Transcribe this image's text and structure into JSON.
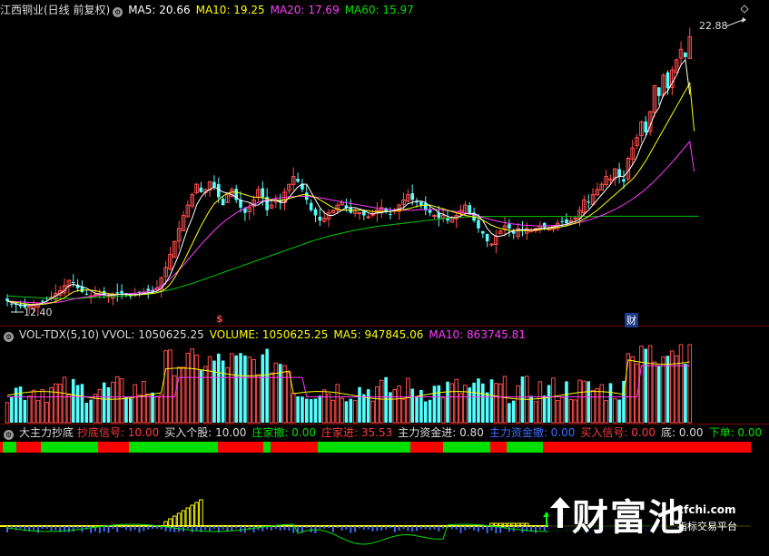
{
  "price_header": {
    "title": "江西铜业(日线 前复权)",
    "ma5": "MA5: 20.66",
    "ma10": "MA10: 19.25",
    "ma20": "MA20: 17.69",
    "ma60": "MA60: 15.97"
  },
  "price_labels": {
    "high": "22.88",
    "low": "12.40",
    "marker_s": "$",
    "marker_cai": "财"
  },
  "vol_header": {
    "title": "VOL-TDX(5,10)",
    "vvol": "VVOL: 1050625.25",
    "volume": "VOLUME: 1050625.25",
    "ma5": "MA5: 947845.06",
    "ma10": "MA10: 863745.81"
  },
  "ind_header": {
    "title": "大主力抄底",
    "bottom_signal": "抄底信号: 10.00",
    "buy_stock": "买入个股: 10.00",
    "dealer_withdraw": "庄家撤: 0.00",
    "dealer_enter": "庄家进: 35.53",
    "capital_in": "主力资金进: 0.80",
    "capital_out": "主力资金撤: 0.00",
    "buy_signal": "买入信号: 0.00",
    "bottom": "底: 0.00",
    "sell": "下单: 0.00"
  },
  "ind_labels": {
    "buy": "买"
  },
  "watermark": {
    "name": "财富池",
    "url": "cfchi.com",
    "sub": "指标交易平台"
  },
  "colors": {
    "up": "#ff4d4d",
    "down": "#54ffff",
    "ma5": "#ffffff",
    "ma10": "#ffff00",
    "ma20": "#ff3bff",
    "ma60": "#00c800",
    "grid": "#7a0000",
    "green_bar": "#00e000",
    "red_bar": "#ff0000"
  },
  "chart_data": {
    "type": "candlestick",
    "x": [
      1,
      2,
      3,
      4,
      5,
      6,
      7,
      8,
      9,
      10,
      11,
      12,
      13,
      14,
      15,
      16,
      17,
      18,
      19,
      20,
      21,
      22,
      23,
      24,
      25,
      26,
      27,
      28,
      29,
      30,
      31,
      32,
      33,
      34,
      35,
      36,
      37,
      38,
      39,
      40,
      41,
      42,
      43,
      44,
      45,
      46,
      47,
      48,
      49,
      50,
      51,
      52,
      53,
      54,
      55,
      56,
      57,
      58,
      59,
      60,
      61,
      62,
      63,
      64,
      65,
      66,
      67,
      68,
      69,
      70,
      71,
      72,
      73,
      74,
      75,
      76,
      77,
      78,
      79,
      80,
      81,
      82,
      83,
      84,
      85,
      86,
      87,
      88,
      89,
      90,
      91,
      92,
      93,
      94,
      95,
      96,
      97,
      98,
      99,
      100,
      101,
      102,
      103,
      104,
      105,
      106,
      107,
      108,
      109,
      110,
      111,
      112,
      113,
      114,
      115,
      116,
      117,
      118,
      119,
      120,
      121,
      122,
      123,
      124,
      125,
      126,
      127,
      128,
      129,
      130,
      131,
      132,
      133,
      134,
      135,
      136,
      137,
      138,
      139,
      140,
      141,
      142,
      143,
      144,
      145,
      146,
      147,
      148,
      149,
      150,
      151,
      152,
      153,
      154,
      155,
      156,
      157,
      158,
      159,
      160,
      161,
      162,
      163,
      164,
      165,
      166,
      167,
      168,
      169,
      170
    ],
    "close": [
      12.7,
      12.6,
      12.55,
      12.5,
      12.45,
      12.5,
      12.55,
      12.6,
      12.7,
      12.8,
      12.85,
      13.0,
      13.1,
      13.3,
      13.5,
      13.4,
      13.2,
      13.05,
      12.95,
      12.9,
      12.95,
      13.0,
      12.95,
      12.9,
      12.95,
      13.0,
      13.0,
      12.95,
      12.9,
      12.95,
      13.0,
      13.05,
      13.1,
      13.05,
      13.2,
      13.6,
      14.0,
      14.5,
      15.0,
      15.5,
      16.0,
      16.4,
      16.8,
      17.2,
      16.9,
      17.0,
      17.3,
      17.1,
      16.7,
      16.4,
      16.8,
      17.0,
      16.6,
      16.3,
      16.1,
      16.3,
      16.6,
      17.0,
      16.7,
      16.2,
      16.4,
      16.6,
      16.5,
      16.9,
      17.2,
      17.5,
      17.3,
      17.0,
      16.6,
      16.2,
      16.0,
      15.8,
      15.9,
      16.1,
      16.2,
      16.4,
      16.5,
      16.3,
      16.1,
      16.2,
      16.1,
      16.0,
      15.95,
      16.05,
      16.2,
      16.3,
      16.15,
      16.05,
      16.2,
      16.4,
      16.6,
      16.8,
      16.6,
      16.5,
      16.4,
      16.2,
      16.1,
      16.0,
      15.9,
      16.0,
      15.8,
      15.9,
      16.0,
      16.2,
      16.4,
      16.1,
      15.8,
      15.5,
      15.3,
      15.0,
      14.9,
      15.2,
      15.4,
      15.6,
      15.5,
      15.3,
      15.5,
      15.4,
      15.5,
      15.45,
      15.5,
      15.6,
      15.55,
      15.5,
      15.6,
      15.7,
      15.75,
      15.7,
      15.8,
      15.9,
      16.2,
      16.6,
      16.5,
      16.8,
      17.0,
      17.2,
      17.5,
      17.4,
      17.8,
      17.5,
      17.3,
      18.2,
      18.6,
      19.0,
      19.6,
      19.2,
      20.0,
      21.0,
      20.6,
      21.4,
      20.9,
      21.6,
      22.0,
      22.4,
      22.1,
      22.88
    ],
    "ma5": [
      12.7,
      12.65,
      12.6,
      12.55,
      12.55,
      12.55,
      12.55,
      12.57,
      12.63,
      12.7,
      12.8,
      12.9,
      13.0,
      13.1,
      13.3,
      13.35,
      13.3,
      13.25,
      13.2,
      13.1,
      13.0,
      12.97,
      12.95,
      12.93,
      12.93,
      12.95,
      12.97,
      12.96,
      12.95,
      12.95,
      12.96,
      12.99,
      13.02,
      13.04,
      13.08,
      13.2,
      13.4,
      13.7,
      14.1,
      14.5,
      15.0,
      15.5,
      15.9,
      16.4,
      16.7,
      16.9,
      17.0,
      17.1,
      17.0,
      16.9,
      16.86,
      16.8,
      16.7,
      16.57,
      16.54,
      16.5,
      16.4,
      16.4,
      16.54,
      16.56,
      16.57,
      16.6,
      16.5,
      16.5,
      16.7,
      16.9,
      17.1,
      17.2,
      17.2,
      16.9,
      16.6,
      16.3,
      16.1,
      16.0,
      16.0,
      16.1,
      16.2,
      16.3,
      16.3,
      16.3,
      16.25,
      16.2,
      16.1,
      16.06,
      16.1,
      16.1,
      16.15,
      16.15,
      16.2,
      16.25,
      16.3,
      16.45,
      16.5,
      16.55,
      16.55,
      16.5,
      16.35,
      16.25,
      16.1,
      16.05,
      15.96,
      15.92,
      15.92,
      15.98,
      16.06,
      16.08,
      16.06,
      16.0,
      15.8,
      15.5,
      15.3,
      15.2,
      15.2,
      15.25,
      15.35,
      15.4,
      15.45,
      15.45,
      15.45,
      15.43,
      15.47,
      15.49,
      15.52,
      15.53,
      15.55,
      15.6,
      15.62,
      15.66,
      15.72,
      15.77,
      15.86,
      16.05,
      16.2,
      16.4,
      16.6,
      16.8,
      17.0,
      17.2,
      17.45,
      17.5,
      17.5,
      17.7,
      17.95,
      18.25,
      18.7,
      19.05,
      19.45,
      19.9,
      20.15,
      20.65,
      20.8,
      21.1,
      21.4,
      21.8,
      22.0,
      20.66
    ],
    "ma10": [
      12.7,
      12.68,
      12.65,
      12.62,
      12.6,
      12.58,
      12.57,
      12.57,
      12.58,
      12.6,
      12.63,
      12.68,
      12.75,
      12.83,
      12.95,
      13.05,
      13.1,
      13.12,
      13.13,
      13.12,
      13.1,
      13.06,
      13.02,
      12.99,
      12.97,
      12.96,
      12.96,
      12.95,
      12.94,
      12.94,
      12.95,
      12.96,
      12.98,
      12.99,
      13.02,
      13.08,
      13.18,
      13.35,
      13.6,
      13.9,
      14.2,
      14.55,
      14.9,
      15.25,
      15.6,
      15.9,
      16.2,
      16.45,
      16.6,
      16.75,
      16.85,
      16.9,
      16.9,
      16.85,
      16.8,
      16.75,
      16.7,
      16.7,
      16.68,
      16.64,
      16.6,
      16.58,
      16.58,
      16.6,
      16.65,
      16.7,
      16.75,
      16.8,
      16.8,
      16.75,
      16.7,
      16.6,
      16.5,
      16.4,
      16.3,
      16.25,
      16.2,
      16.2,
      16.2,
      16.2,
      16.2,
      16.2,
      16.18,
      16.15,
      16.15,
      16.15,
      16.15,
      16.15,
      16.18,
      16.2,
      16.22,
      16.26,
      16.3,
      16.35,
      16.38,
      16.4,
      16.4,
      16.35,
      16.3,
      16.25,
      16.2,
      16.15,
      16.1,
      16.05,
      16.0,
      15.97,
      15.94,
      15.9,
      15.82,
      15.72,
      15.62,
      15.55,
      15.5,
      15.45,
      15.43,
      15.42,
      15.42,
      15.42,
      15.42,
      15.43,
      15.44,
      15.45,
      15.47,
      15.49,
      15.51,
      15.54,
      15.57,
      15.6,
      15.65,
      15.7,
      15.77,
      15.86,
      15.96,
      16.08,
      16.2,
      16.35,
      16.5,
      16.65,
      16.8,
      16.95,
      17.1,
      17.25,
      17.4,
      17.6,
      17.85,
      18.1,
      18.4,
      18.7,
      19.0,
      19.3,
      19.6,
      19.9,
      20.2,
      20.5,
      20.8,
      21.1,
      19.25
    ],
    "ma20": [
      12.7,
      12.69,
      12.68,
      12.67,
      12.66,
      12.65,
      12.64,
      12.63,
      12.63,
      12.63,
      12.64,
      12.65,
      12.67,
      12.7,
      12.74,
      12.78,
      12.81,
      12.84,
      12.86,
      12.88,
      12.9,
      12.92,
      12.93,
      12.94,
      12.95,
      12.96,
      12.97,
      12.98,
      12.99,
      13.0,
      13.02,
      13.04,
      13.07,
      13.12,
      13.2,
      13.3,
      13.42,
      13.56,
      13.72,
      13.9,
      14.08,
      14.28,
      14.48,
      14.68,
      14.88,
      15.06,
      15.24,
      15.42,
      15.58,
      15.72,
      15.86,
      15.98,
      16.1,
      16.2,
      16.28,
      16.36,
      16.44,
      16.5,
      16.55,
      16.6,
      16.63,
      16.66,
      16.68,
      16.7,
      16.72,
      16.73,
      16.74,
      16.74,
      16.73,
      16.72,
      16.7,
      16.68,
      16.65,
      16.62,
      16.58,
      16.55,
      16.52,
      16.49,
      16.46,
      16.43,
      16.4,
      16.37,
      16.34,
      16.31,
      16.28,
      16.26,
      16.24,
      16.22,
      16.21,
      16.2,
      16.2,
      16.2,
      16.2,
      16.21,
      16.22,
      16.23,
      16.23,
      16.23,
      16.22,
      16.21,
      16.19,
      16.17,
      16.15,
      16.12,
      16.09,
      16.05,
      16.01,
      15.97,
      15.93,
      15.88,
      15.83,
      15.79,
      15.75,
      15.72,
      15.69,
      15.67,
      15.65,
      15.63,
      15.62,
      15.61,
      15.6,
      15.6,
      15.6,
      15.6,
      15.61,
      15.62,
      15.63,
      15.65,
      15.67,
      15.7,
      15.73,
      15.77,
      15.82,
      15.88,
      15.94,
      16.0,
      16.07,
      16.15,
      16.23,
      16.32,
      16.42,
      16.52,
      16.63,
      16.75,
      16.88,
      17.02,
      17.17,
      17.33,
      17.5,
      17.68,
      17.86,
      18.05,
      18.25,
      18.45,
      18.65,
      18.85,
      17.69
    ],
    "ma60": [
      12.9,
      12.89,
      12.88,
      12.87,
      12.86,
      12.85,
      12.84,
      12.83,
      12.82,
      12.81,
      12.8,
      12.8,
      12.8,
      12.8,
      12.8,
      12.8,
      12.8,
      12.81,
      12.82,
      12.83,
      12.84,
      12.85,
      12.86,
      12.87,
      12.88,
      12.89,
      12.9,
      12.91,
      12.92,
      12.93,
      12.94,
      12.96,
      12.98,
      13.0,
      13.03,
      13.06,
      13.1,
      13.14,
      13.18,
      13.23,
      13.28,
      13.33,
      13.38,
      13.44,
      13.5,
      13.56,
      13.62,
      13.68,
      13.74,
      13.8,
      13.86,
      13.92,
      13.98,
      14.04,
      14.1,
      14.16,
      14.22,
      14.28,
      14.34,
      14.4,
      14.46,
      14.52,
      14.58,
      14.64,
      14.7,
      14.76,
      14.82,
      14.88,
      14.94,
      15.0,
      15.05,
      15.1,
      15.15,
      15.2,
      15.24,
      15.28,
      15.32,
      15.36,
      15.4,
      15.43,
      15.46,
      15.49,
      15.52,
      15.55,
      15.58,
      15.6,
      15.62,
      15.64,
      15.66,
      15.68,
      15.7,
      15.72,
      15.74,
      15.76,
      15.78,
      15.8,
      15.82,
      15.84,
      15.86,
      15.88,
      15.9,
      15.91,
      15.92,
      15.93,
      15.94,
      15.95,
      15.96,
      15.96,
      15.96,
      15.96,
      15.96,
      15.96,
      15.96,
      15.96,
      15.96,
      15.96,
      15.96,
      15.96,
      15.96,
      15.96,
      15.96,
      15.96,
      15.96,
      15.96,
      15.96,
      15.96,
      15.96,
      15.96,
      15.96,
      15.96,
      15.96,
      15.96,
      15.96,
      15.96,
      15.96,
      15.97,
      15.97,
      15.97,
      15.97,
      15.97,
      15.97,
      15.97,
      15.97,
      15.97,
      15.97,
      15.97,
      15.97,
      15.97,
      15.97,
      15.97,
      15.97,
      15.97,
      15.97,
      15.97,
      15.97,
      15.97,
      15.97,
      15.97
    ],
    "ylim": [
      12.0,
      23.6
    ]
  }
}
